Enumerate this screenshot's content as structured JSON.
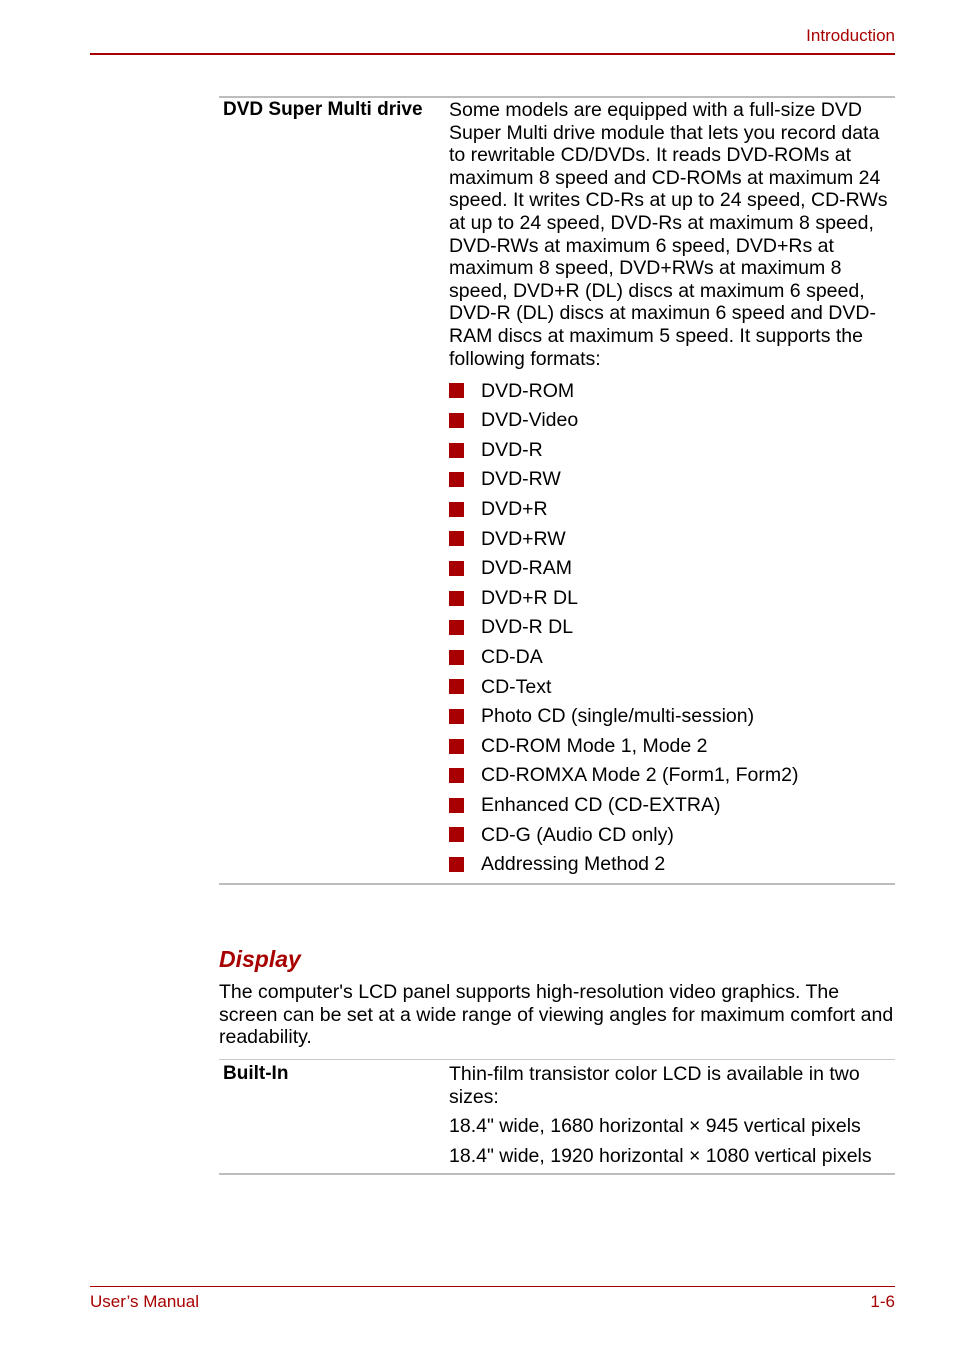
{
  "header": {
    "title": "Introduction"
  },
  "footer": {
    "left": "User’s Manual",
    "right": "1-6"
  },
  "dvd_table": {
    "term": "DVD Super Multi drive",
    "description": "Some models are equipped with a full-size DVD Super Multi drive module that lets you record data to rewritable CD/DVDs. It reads DVD-ROMs at maximum 8 speed and CD-ROMs at maximum 24 speed. It writes CD-Rs at up to 24 speed, CD-RWs at up to 24 speed, DVD-Rs at maximum 8 speed, DVD-RWs at maximum 6 speed, DVD+Rs at maximum 8 speed, DVD+RWs at maximum 8 speed, DVD+R (DL) discs at maximum 6 speed, DVD-R (DL) discs at maximun 6 speed and DVD-RAM discs at maximum 5 speed. It supports the following formats:",
    "formats": [
      "DVD-ROM",
      "DVD-Video",
      "DVD-R",
      "DVD-RW",
      "DVD+R",
      "DVD+RW",
      "DVD-RAM",
      "DVD+R DL",
      "DVD-R DL",
      "CD-DA",
      "CD-Text",
      "Photo CD (single/multi-session)",
      "CD-ROM Mode 1, Mode 2",
      "CD-ROMXA Mode 2 (Form1, Form2)",
      "Enhanced CD (CD-EXTRA)",
      "CD-G (Audio CD only)",
      "Addressing Method 2"
    ]
  },
  "display_section": {
    "title": "Display",
    "paragraph": "The computer's LCD panel supports high-resolution video graphics. The screen can be set at a wide range of viewing angles for maximum comfort and readability.",
    "table": {
      "term": "Built-In",
      "lines": [
        "Thin-film transistor color LCD is available in two sizes:",
        "18.4\" wide, 1680 horizontal × 945 vertical pixels",
        "18.4\" wide, 1920 horizontal × 1080 vertical pixels"
      ]
    }
  },
  "colors": {
    "accent": "#a80000",
    "rule": "#bdbdbd"
  }
}
